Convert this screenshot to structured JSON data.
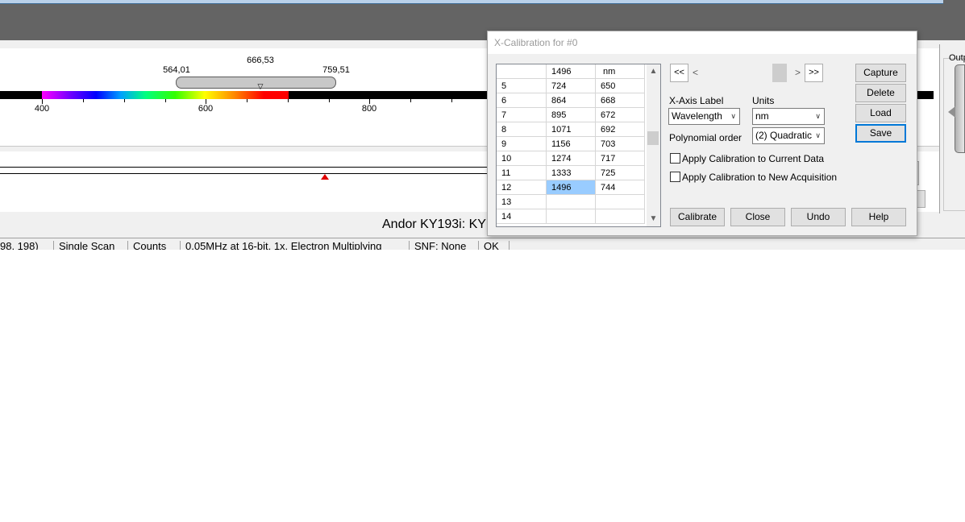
{
  "background_app": {
    "ruler": {
      "range_labels": [
        "564,01",
        "666,53",
        "759,51"
      ],
      "axis_labels": [
        "400",
        "600",
        "800"
      ]
    },
    "device_title": "Andor KY193i: KY",
    "right_panel_label": "Outp",
    "status_bar": [
      "98, 198)",
      "Single Scan",
      "Counts",
      "0.05MHz at 16-bit, 1x, Electron Multiplying",
      "SNF: None",
      "OK"
    ]
  },
  "dialog": {
    "title": "X-Calibration for #0",
    "table": {
      "header": [
        "",
        "1496",
        "nm"
      ],
      "rows": [
        [
          "5",
          "724",
          "650"
        ],
        [
          "6",
          "864",
          "668"
        ],
        [
          "7",
          "895",
          "672"
        ],
        [
          "8",
          "1071",
          "692"
        ],
        [
          "9",
          "1156",
          "703"
        ],
        [
          "10",
          "1274",
          "717"
        ],
        [
          "11",
          "1333",
          "725"
        ],
        [
          "12",
          "1496",
          "744"
        ],
        [
          "13",
          "",
          ""
        ],
        [
          "14",
          "",
          ""
        ]
      ]
    },
    "nav": {
      "first": "<<",
      "prev": "<",
      "next": ">",
      "last": ">>"
    },
    "x_axis_label": {
      "label": "X-Axis Label",
      "value": "Wavelength"
    },
    "units": {
      "label": "Units",
      "value": "nm"
    },
    "polynomial_order": {
      "label": "Polynomial order",
      "value": "(2) Quadratic"
    },
    "apply_current": "Apply Calibration to Current Data",
    "apply_new": "Apply Calibration to New Acquisition",
    "side_buttons": {
      "capture": "Capture",
      "delete": "Delete",
      "load": "Load",
      "save": "Save"
    },
    "bottom_buttons": {
      "calibrate": "Calibrate",
      "close": "Close",
      "undo": "Undo",
      "help": "Help"
    }
  }
}
